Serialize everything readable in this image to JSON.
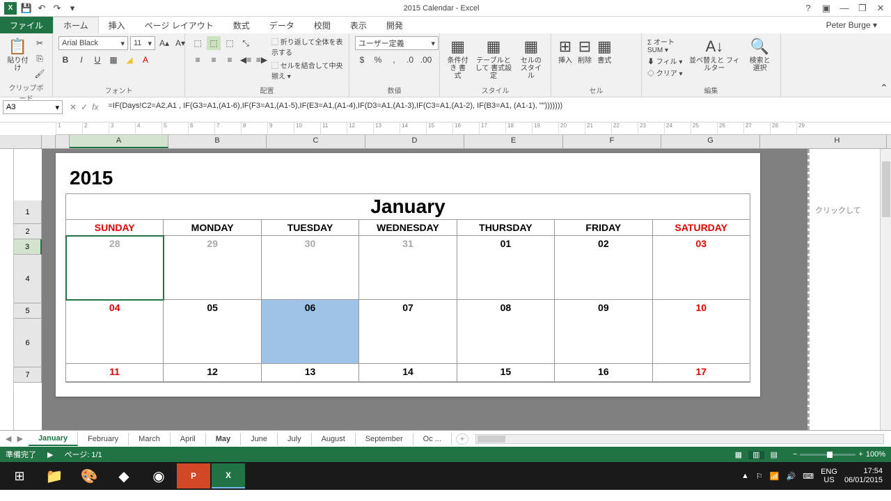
{
  "titlebar": {
    "title": "2015 Calendar - Excel"
  },
  "user": "Peter Burge",
  "tabs": {
    "file": "ファイル",
    "home": "ホーム",
    "insert": "挿入",
    "pageLayout": "ページ レイアウト",
    "formulas": "数式",
    "data": "データ",
    "review": "校閲",
    "view": "表示",
    "developer": "開発"
  },
  "ribbon": {
    "clipboard": {
      "paste": "貼り付け",
      "label": "クリップボード"
    },
    "font": {
      "name": "Arial Black",
      "size": "11",
      "label": "フォント"
    },
    "align": {
      "wrap": "折り返して全体を表示する",
      "merge": "セルを結合して中央揃え",
      "label": "配置"
    },
    "number": {
      "format": "ユーザー定義",
      "label": "数値"
    },
    "styles": {
      "cond": "条件付き\n書式",
      "table": "テーブルとして\n書式設定",
      "cell": "セルの\nスタイル",
      "label": "スタイル"
    },
    "cells": {
      "insert": "挿入",
      "delete": "削除",
      "format": "書式",
      "label": "セル"
    },
    "editing": {
      "sum": "オート SUM",
      "fill": "フィル",
      "clear": "クリア",
      "sort": "並べ替えと\nフィルター",
      "find": "検索と\n選択",
      "label": "編集"
    }
  },
  "formulaBar": {
    "cell": "A3",
    "formula": "=IF(Days!C2=A2,A1 , IF(G3=A1,(A1-6),IF(F3=A1,(A1-5),IF(E3=A1,(A1-4),IF(D3=A1,(A1-3),IF(C3=A1,(A1-2), IF(B3=A1, (A1-1), \"\")))))))"
  },
  "columns": [
    "A",
    "B",
    "C",
    "D",
    "E",
    "F",
    "G",
    "H"
  ],
  "rows": [
    "1",
    "2",
    "3",
    "4",
    "5",
    "6",
    "7"
  ],
  "calendar": {
    "year": "2015",
    "month": "January",
    "dow": [
      "SUNDAY",
      "MONDAY",
      "TUESDAY",
      "WEDNESDAY",
      "THURSDAY",
      "FRIDAY",
      "SATURDAY"
    ],
    "w1": [
      "28",
      "29",
      "30",
      "31",
      "01",
      "02",
      "03"
    ],
    "w2": [
      "04",
      "05",
      "06",
      "07",
      "08",
      "09",
      "10"
    ],
    "w3": [
      "11",
      "12",
      "13",
      "14",
      "15",
      "16",
      "17"
    ]
  },
  "sidePane": "クリックして",
  "sheets": [
    "January",
    "February",
    "March",
    "April",
    "May",
    "June",
    "July",
    "August",
    "September",
    "Oc ..."
  ],
  "status": {
    "ready": "準備完了",
    "page": "ページ: 1/1",
    "zoom": "100%"
  },
  "tray": {
    "lang1": "ENG",
    "lang2": "US",
    "time": "17:54",
    "date": "06/01/2015"
  }
}
